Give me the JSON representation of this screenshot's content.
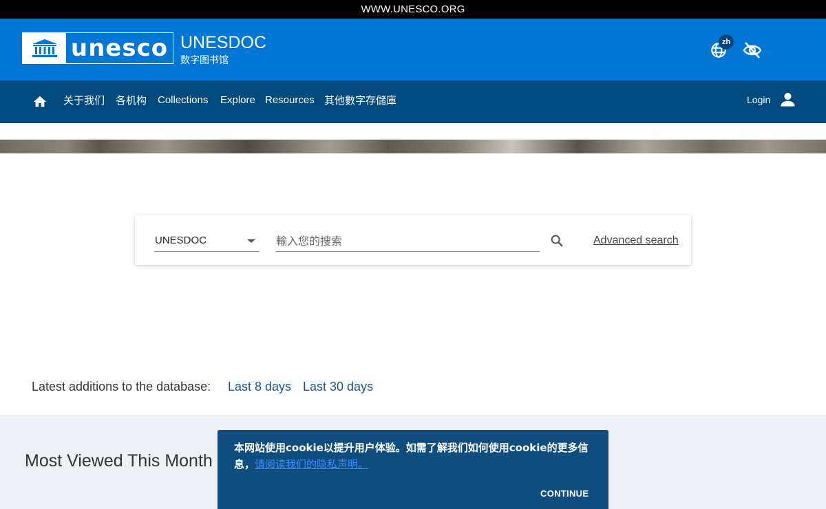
{
  "topbar": {
    "link": "WWW.UNESCO.ORG"
  },
  "header": {
    "logo_word": "unesco",
    "title": "UNESDOC",
    "subtitle": "数字图书馆",
    "lang_badge": "zh",
    "colors": {
      "header_bg": "#0077d4",
      "nav_bg": "#004a80"
    }
  },
  "nav": {
    "items": [
      "关于我们",
      "各机构",
      "Collections",
      "Explore",
      "Resources",
      "其他數字存儲庫"
    ],
    "login": "Login"
  },
  "search": {
    "database": "UNESDOC",
    "placeholder": "輸入您的搜索",
    "value": "",
    "advanced": "Advanced search"
  },
  "latest": {
    "label": "Latest additions to the database:",
    "links": [
      "Last 8 days",
      "Last 30 days"
    ]
  },
  "most_viewed": {
    "title": "Most Viewed This Month"
  },
  "cookie": {
    "text": "本网站使用cookie以提升用户体验。如需了解我们如何使用cookie的更多信息，",
    "link": "请阅读我们的隐私声明。",
    "button": "CONTINUE"
  },
  "icons": [
    "home-icon",
    "globe-icon",
    "eye-off-icon",
    "user-icon",
    "search-icon",
    "chevron-down-icon",
    "unesco-temple-icon"
  ]
}
